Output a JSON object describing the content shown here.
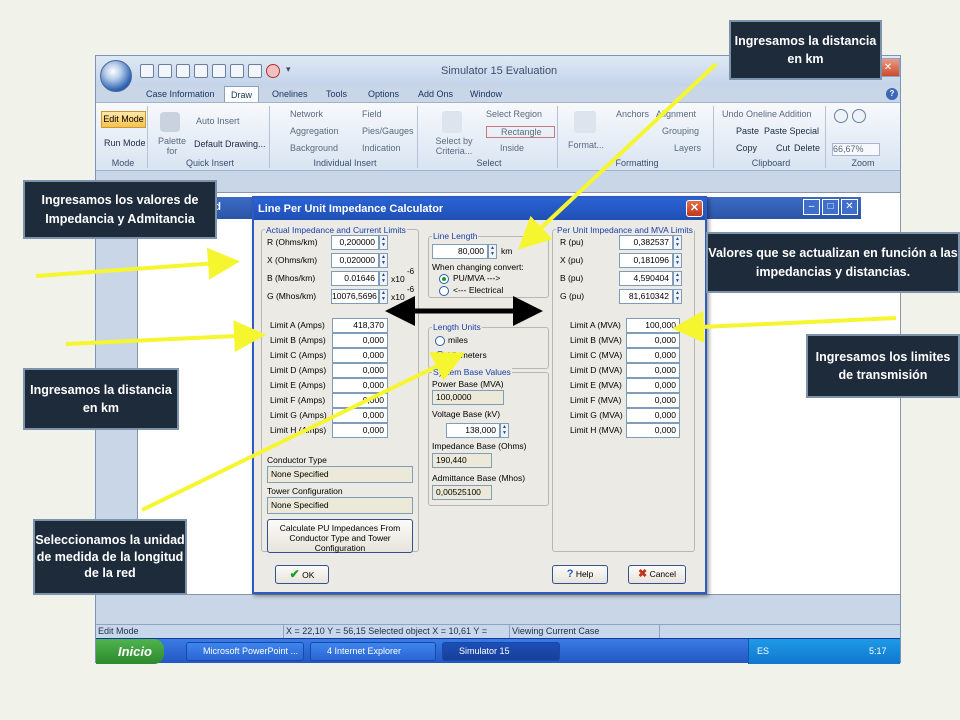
{
  "app": {
    "title": "Simulator 15 Evaluation",
    "tabs": [
      "Case Information",
      "Draw",
      "Onelines",
      "Tools",
      "Options",
      "Add Ons",
      "Window"
    ],
    "active_tab": "Draw",
    "ribbon": {
      "mode": {
        "label": "Mode",
        "edit_mode": "Edit Mode",
        "run_mode": "Run Mode"
      },
      "quick_insert": {
        "label": "Quick Insert",
        "auto_insert": "Auto Insert",
        "palette": "Palette for",
        "default_drawing": "Default Drawing..."
      },
      "individual_insert": {
        "label": "Individual Insert",
        "network": "Network",
        "aggregation": "Aggregation",
        "background": "Background",
        "field": "Field",
        "pies_gauges": "Pies/Gauges",
        "indication": "Indication"
      },
      "select": {
        "label": "Select",
        "select_by_criteria": "Select by Criteria...",
        "select_region": "Select Region",
        "rectangle": "Rectangle",
        "inside": "Inside"
      },
      "formatting": {
        "label": "Formatting",
        "format": "Format...",
        "anchors": "Anchors",
        "alignment": "Alignment",
        "grouping": "Grouping",
        "layers": "Layers"
      },
      "clipboard": {
        "label": "Clipboard",
        "undo": "Undo Oneline Addition",
        "paste": "Paste",
        "paste_special": "Paste Special",
        "copy": "Copy",
        "cut": "Cut",
        "delete": "Delete"
      },
      "zoom": {
        "label": "Zoom",
        "level": "66,67%"
      }
    },
    "doc_fragment": "rd",
    "status": {
      "mode": "Edit Mode",
      "coords": "X = 22,10 Y = 56,15 Selected object X = 10,61 Y = 77,00",
      "case": "Viewing Current Case"
    },
    "taskbar": {
      "start": "Inicio",
      "tasks": [
        "Microsoft PowerPoint ...",
        "4 Internet Explorer",
        "Simulator 15"
      ],
      "lang": "ES",
      "time": "5:17"
    }
  },
  "dialog": {
    "title": "Line Per Unit Impedance Calculator",
    "actual": {
      "group_title": "Actual Impedance and Current Limits",
      "fields": [
        {
          "label": "R (Ohms/km)",
          "value": "0,200000"
        },
        {
          "label": "X (Ohms/km)",
          "value": "0,020000"
        },
        {
          "label": "B (Mhos/km)",
          "value": "0.01646",
          "exp": "x10",
          "sup": "-6"
        },
        {
          "label": "G (Mhos/km)",
          "value": "10076,5696",
          "exp": "x10",
          "sup": "-6"
        }
      ],
      "limits": [
        {
          "label": "Limit A (Amps)",
          "value": "418,370"
        },
        {
          "label": "Limit B (Amps)",
          "value": "0,000"
        },
        {
          "label": "Limit C (Amps)",
          "value": "0,000"
        },
        {
          "label": "Limit D (Amps)",
          "value": "0,000"
        },
        {
          "label": "Limit E (Amps)",
          "value": "0,000"
        },
        {
          "label": "Limit F (Amps)",
          "value": "0,000"
        },
        {
          "label": "Limit G (Amps)",
          "value": "0,000"
        },
        {
          "label": "Limit H (Amps)",
          "value": "0,000"
        }
      ],
      "conductor_type_label": "Conductor Type",
      "conductor_type_value": "None Specified",
      "tower_config_label": "Tower Configuration",
      "tower_config_value": "None Specified",
      "calculate_button": "Calculate PU Impedances From Conductor Type and Tower Configuration"
    },
    "line_length": {
      "group_title": "Line Length",
      "value": "80,000",
      "unit": "km",
      "convert_label": "When changing convert:",
      "opt_pu": "PU/MVA --->",
      "opt_electrical": "<--- Electrical"
    },
    "length_units": {
      "group_title": "Length Units",
      "miles": "miles",
      "kilometers": "kilometers"
    },
    "system_base": {
      "group_title": "System Base Values",
      "power_label": "Power Base (MVA)",
      "power_value": "100,0000",
      "voltage_label": "Voltage Base (kV)",
      "voltage_value": "138,000",
      "impedance_label": "Impedance Base (Ohms)",
      "impedance_value": "190,440",
      "admittance_label": "Admittance Base (Mhos)",
      "admittance_value": "0,00525100"
    },
    "per_unit": {
      "group_title": "Per Unit Impedance and MVA Limits",
      "fields": [
        {
          "label": "R (pu)",
          "value": "0,382537"
        },
        {
          "label": "X (pu)",
          "value": "0,181096"
        },
        {
          "label": "B (pu)",
          "value": "4,590404"
        },
        {
          "label": "G (pu)",
          "value": "81,610342"
        }
      ],
      "limits": [
        {
          "label": "Limit A (MVA)",
          "value": "100,000"
        },
        {
          "label": "Limit B (MVA)",
          "value": "0,000"
        },
        {
          "label": "Limit C (MVA)",
          "value": "0,000"
        },
        {
          "label": "Limit D (MVA)",
          "value": "0,000"
        },
        {
          "label": "Limit E (MVA)",
          "value": "0,000"
        },
        {
          "label": "Limit F (MVA)",
          "value": "0,000"
        },
        {
          "label": "Limit G (MVA)",
          "value": "0,000"
        },
        {
          "label": "Limit H (MVA)",
          "value": "0,000"
        }
      ]
    },
    "ok": "OK",
    "help": "Help",
    "cancel": "Cancel"
  },
  "callouts": {
    "top_right": "Ingresamos la distancia en km",
    "left_top": "Ingresamos los valores de Impedancia y Admitancia",
    "right_top": "Valores que se actualizan en función a las impedancias y distancias.",
    "right_mid": "Ingresamos los limites de transmisión",
    "left_mid": "Ingresamos la distancia en km",
    "left_bottom": "Seleccionamos la unidad de medida de la longitud de la red"
  },
  "colors": {
    "arrow": "#f5f530",
    "callout_bg": "#1e2b3b",
    "dialog_title": "#2a63d4"
  }
}
